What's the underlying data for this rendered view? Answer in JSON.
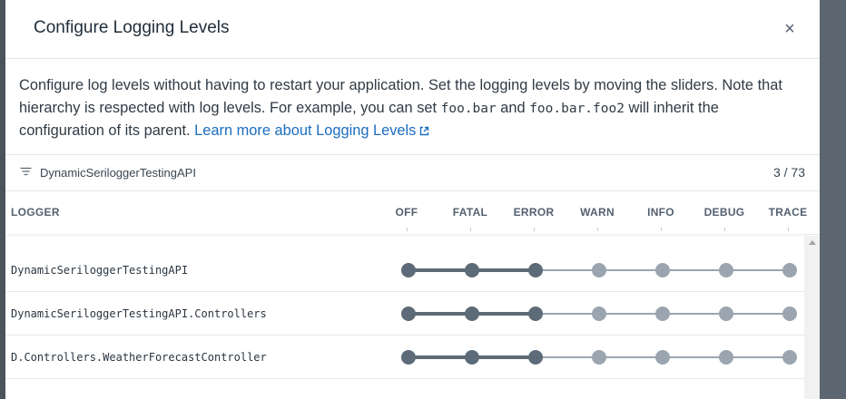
{
  "dialog": {
    "title": "Configure Logging Levels",
    "close_label": "×",
    "description": {
      "part1": "Configure log levels without having to restart your application. Set the logging levels by moving the sliders. Note that hierarchy is respected with log levels. For example, you can set ",
      "code1": "foo.bar",
      "part2": " and ",
      "code2": "foo.bar.foo2",
      "part3": " will inherit the configuration of its parent. ",
      "link": "Learn more about Logging Levels"
    }
  },
  "filter": {
    "icon": "filter-icon",
    "value": "DynamicSeriloggerTestingAPI",
    "count": "3 / 73"
  },
  "table": {
    "logger_header": "LOGGER",
    "levels": [
      "OFF",
      "FATAL",
      "ERROR",
      "WARN",
      "INFO",
      "DEBUG",
      "TRACE"
    ],
    "rows": [
      {
        "name": "DynamicSeriloggerTestingAPI",
        "level": "ERROR"
      },
      {
        "name": "DynamicSeriloggerTestingAPI.Controllers",
        "level": "ERROR"
      },
      {
        "name": "D.Controllers.WeatherForecastController",
        "level": "ERROR"
      }
    ]
  },
  "colors": {
    "active": "#5c6b77",
    "inactive": "#9aa5b0",
    "link": "#1b6dc1"
  }
}
